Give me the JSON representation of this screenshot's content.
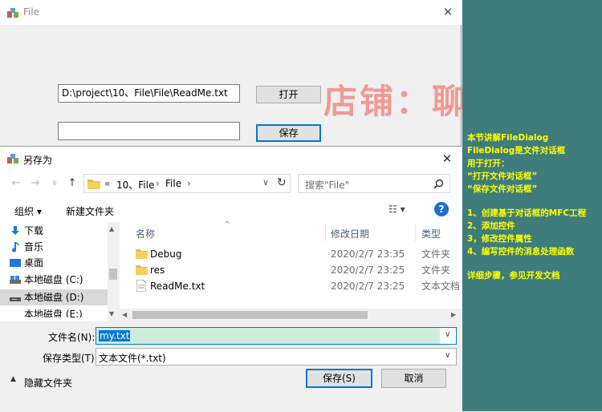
{
  "main": {
    "title": "File",
    "close": "✕",
    "path_value": "D:\\project\\10、File\\File\\ReadMe.txt",
    "save_value": "",
    "open_label": "打开",
    "save_label": "保存"
  },
  "watermark": "店铺：聊阳电子",
  "notes": [
    "本节讲解FileDialog",
    "FileDialog是文件对话框",
    "用于打开：",
    "“打开文件对话框”",
    "“保存文件对话框”",
    "1、创建基于对话框的MFC工程",
    "2、添加控件",
    "3，修改控件属性",
    "4、编写控件的消息处理函数",
    "详细步骤，参见开发文档"
  ],
  "dialog": {
    "title": "另存为",
    "close": "✕",
    "nav": {
      "back": "←",
      "forward": "→",
      "down": "∨",
      "up": "↑"
    },
    "breadcrumb": {
      "chev": "«",
      "part1": "10、File",
      "sep": "›",
      "part2": "File",
      "refresh": "↻"
    },
    "search_placeholder": "搜索\"File\"",
    "toolbar": {
      "organize": "组织 ▾",
      "new_folder": "新建文件夹",
      "view": "☷ ▾",
      "help": "?"
    },
    "nav_items": [
      {
        "label": "下载",
        "icon": "download-icon"
      },
      {
        "label": "音乐",
        "icon": "music-icon"
      },
      {
        "label": "桌面",
        "icon": "desktop-icon"
      },
      {
        "label": "本地磁盘 (C:)",
        "icon": "drive-icon"
      },
      {
        "label": "本地磁盘 (D:)",
        "icon": "drive-icon",
        "selected": true
      },
      {
        "label": "本地磁盘 (E:)",
        "icon": "drive-icon"
      }
    ],
    "columns": {
      "name": "名称",
      "date": "修改日期",
      "type": "类型"
    },
    "files": [
      {
        "name": "Debug",
        "date": "2020/2/7 23:35",
        "type": "文件夹",
        "icon": "folder-icon"
      },
      {
        "name": "res",
        "date": "2020/2/7 23:25",
        "type": "文件夹",
        "icon": "folder-icon"
      },
      {
        "name": "ReadMe.txt",
        "date": "2020/2/7 23:25",
        "type": "文本文档",
        "icon": "text-file-icon"
      }
    ],
    "filename_label": "文件名(N):",
    "filename_value": "my.txt",
    "filetype_label": "保存类型(T):",
    "filetype_value": "文本文件(*.txt)",
    "hide_folders": "隐藏文件夹",
    "save_button": "保存(S)",
    "cancel_button": "取消"
  },
  "colors": {
    "accent": "#0078d7",
    "panel": "#3f7d7d",
    "note": "#ffff00",
    "watermark": "#f08c86",
    "selection": "#cde8ff"
  }
}
